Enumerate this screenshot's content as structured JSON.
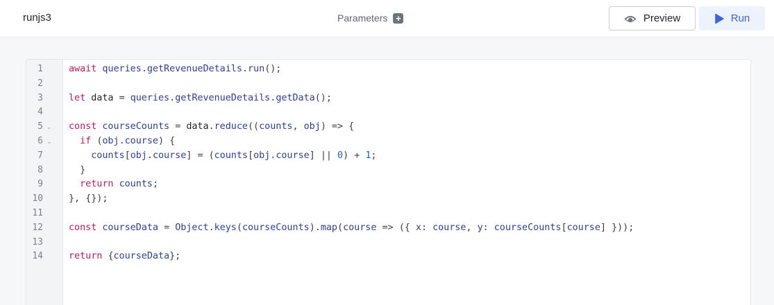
{
  "header": {
    "title": "runjs3",
    "parameters_label": "Parameters",
    "parameters_add_icon": "plus-icon",
    "preview_label": "Preview",
    "preview_icon": "eye-icon",
    "run_label": "Run",
    "run_icon": "play-icon"
  },
  "editor": {
    "lines": [
      {
        "num": "1",
        "code": "await queries.getRevenueDetails.run();"
      },
      {
        "num": "2",
        "code": ""
      },
      {
        "num": "3",
        "code": "let data = queries.getRevenueDetails.getData();"
      },
      {
        "num": "4",
        "code": ""
      },
      {
        "num": "5",
        "code": "const courseCounts = data.reduce((counts, obj) => {",
        "foldable": true
      },
      {
        "num": "6",
        "code": "  if (obj.course) {",
        "foldable": true
      },
      {
        "num": "7",
        "code": "    counts[obj.course] = (counts[obj.course] || 0) + 1;"
      },
      {
        "num": "8",
        "code": "  }"
      },
      {
        "num": "9",
        "code": "  return counts;"
      },
      {
        "num": "10",
        "code": "}, {});"
      },
      {
        "num": "11",
        "code": ""
      },
      {
        "num": "12",
        "code": "const courseData = Object.keys(courseCounts).map(course => ({ x: course, y: courseCounts[course] }));"
      },
      {
        "num": "13",
        "code": ""
      },
      {
        "num": "14",
        "code": "return {courseData};"
      }
    ]
  },
  "colors": {
    "keyword": "#c2185b",
    "identifier": "#2c3e99",
    "number": "#1565c0",
    "run_accent": "#3e63dd"
  }
}
